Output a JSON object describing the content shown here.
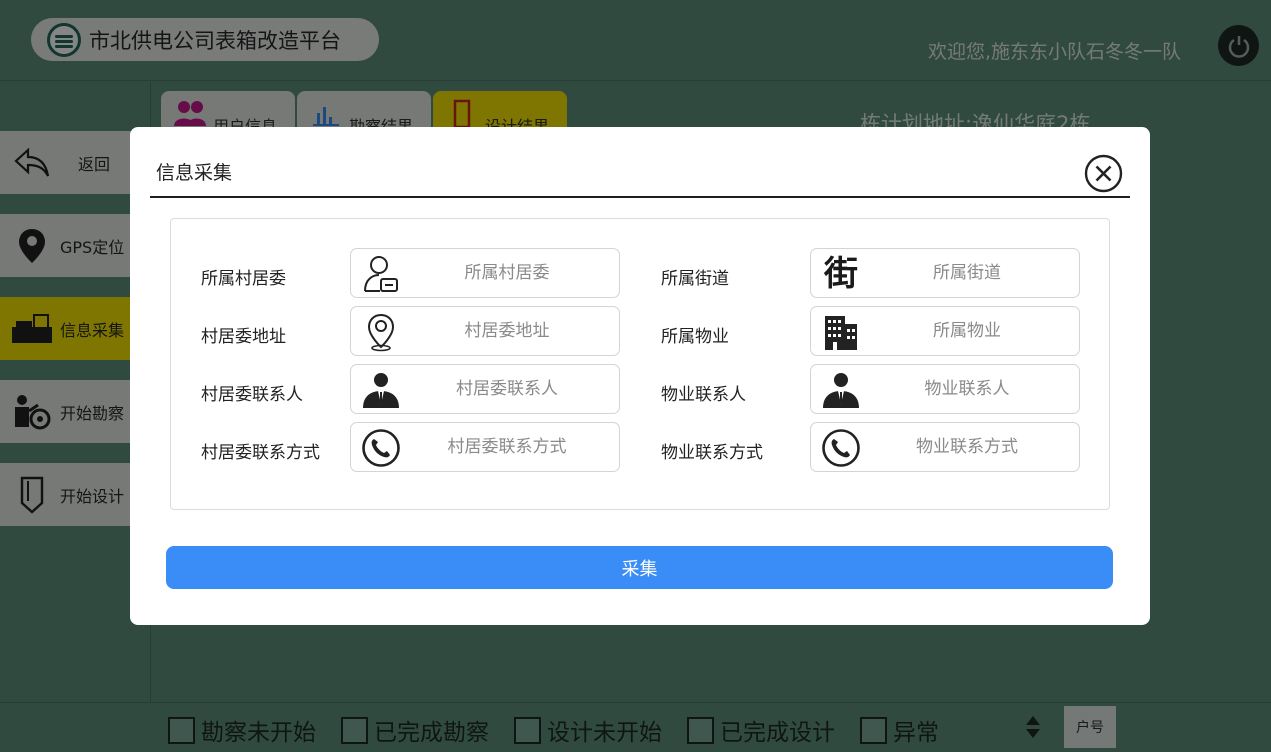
{
  "header": {
    "title": "市北供电公司表箱改造平台",
    "welcome": "欢迎您,施东东小队石冬冬一队"
  },
  "sidebar": {
    "items": [
      {
        "label": "返回",
        "icon": "back-arrow-icon"
      },
      {
        "label": "GPS定位",
        "icon": "location-pin-icon"
      },
      {
        "label": "信息采集",
        "icon": "collect-icon",
        "active": true
      },
      {
        "label": "开始勘察",
        "icon": "survey-icon"
      },
      {
        "label": "开始设计",
        "icon": "design-pen-icon"
      }
    ]
  },
  "tabs": [
    {
      "label": "用户信息",
      "icon": "users-icon"
    },
    {
      "label": "勘察结果",
      "icon": "bar-chart-icon"
    },
    {
      "label": "设计结果",
      "icon": "bookmark-icon"
    }
  ],
  "plan_address": "栋计划地址:逸仙华庭2栋",
  "filters": [
    {
      "label": "勘察未开始"
    },
    {
      "label": "已完成勘察"
    },
    {
      "label": "设计未开始"
    },
    {
      "label": "已完成设计"
    },
    {
      "label": "异常"
    }
  ],
  "sort_button": "户号",
  "modal": {
    "title": "信息采集",
    "fields": [
      {
        "label": "所属村居委",
        "placeholder": "所属村居委",
        "value": "",
        "icon": "person-badge-icon"
      },
      {
        "label": "所属街道",
        "placeholder": "所属街道",
        "value": "",
        "icon": "street-icon",
        "icon_glyph": "街"
      },
      {
        "label": "村居委地址",
        "placeholder": "村居委地址",
        "value": "",
        "icon": "location-pin-icon"
      },
      {
        "label": "所属物业",
        "placeholder": "所属物业",
        "value": "",
        "icon": "building-icon"
      },
      {
        "label": "村居委联系人",
        "placeholder": "村居委联系人",
        "value": "",
        "icon": "person-suit-icon"
      },
      {
        "label": "物业联系人",
        "placeholder": "物业联系人",
        "value": "",
        "icon": "person-suit-icon"
      },
      {
        "label": "村居委联系方式",
        "placeholder": "村居委联系方式",
        "value": "",
        "icon": "phone-icon"
      },
      {
        "label": "物业联系方式",
        "placeholder": "物业联系方式",
        "value": "",
        "icon": "phone-icon"
      }
    ],
    "submit_label": "采集"
  },
  "colors": {
    "app_bg": "#5f8f7b",
    "active_yellow": "#f1e300",
    "primary_blue": "#3a8cf6"
  }
}
